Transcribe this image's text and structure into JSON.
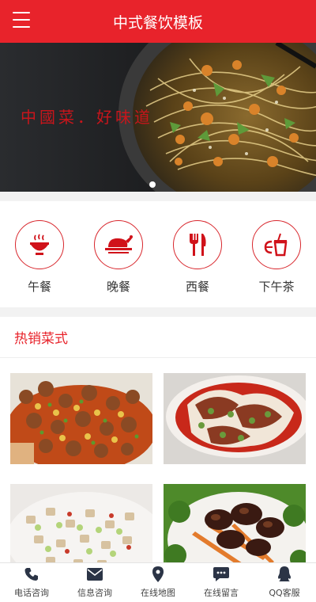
{
  "header": {
    "title": "中式餐饮模板",
    "menu_icon": "hamburger-menu-icon"
  },
  "banner": {
    "slogan": "中國菜．好味道",
    "slides": 1,
    "active_slide": 1
  },
  "categories": [
    {
      "label": "午餐",
      "icon": "rice-bowl-icon"
    },
    {
      "label": "晚餐",
      "icon": "roast-chicken-icon"
    },
    {
      "label": "西餐",
      "icon": "fork-knife-icon"
    },
    {
      "label": "下午茶",
      "icon": "drink-cup-icon"
    }
  ],
  "section": {
    "title": "热销菜式"
  },
  "dishes": [
    {
      "image": "braised-mushrooms-dish-photo"
    },
    {
      "image": "spicy-beef-tripe-dish-photo"
    },
    {
      "image": "diced-vegetables-dish-photo"
    },
    {
      "image": "shiitake-vegetable-dish-photo"
    }
  ],
  "footer": [
    {
      "label": "电话咨询",
      "icon": "phone-icon"
    },
    {
      "label": "信息咨询",
      "icon": "envelope-icon"
    },
    {
      "label": "在线地图",
      "icon": "map-pin-icon"
    },
    {
      "label": "在线留言",
      "icon": "chat-bubble-icon"
    },
    {
      "label": "QQ客服",
      "icon": "qq-penguin-icon"
    }
  ],
  "colors": {
    "brand_red": "#e8232b",
    "banner_dark": "#1f2124",
    "divider_gray": "#f2f2f2"
  }
}
